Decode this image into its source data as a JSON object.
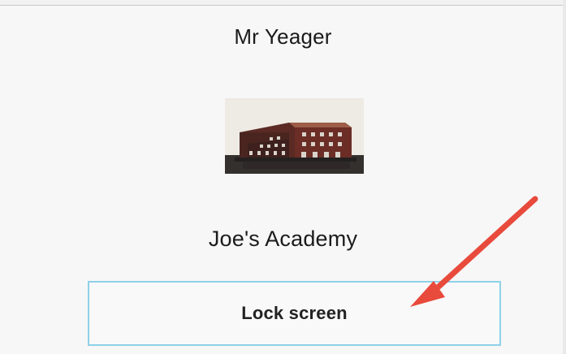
{
  "profile": {
    "user_name": "Mr Yeager",
    "school_name": "Joe's Academy",
    "school_image": "school-building-photo"
  },
  "actions": {
    "lock_screen_label": "Lock screen"
  },
  "annotation": {
    "arrow_icon": "red-arrow-icon",
    "color": "#e84a3c"
  },
  "colors": {
    "background": "#f7f7f7",
    "button_border": "#8fd0e8",
    "text": "#1b1b1b"
  }
}
